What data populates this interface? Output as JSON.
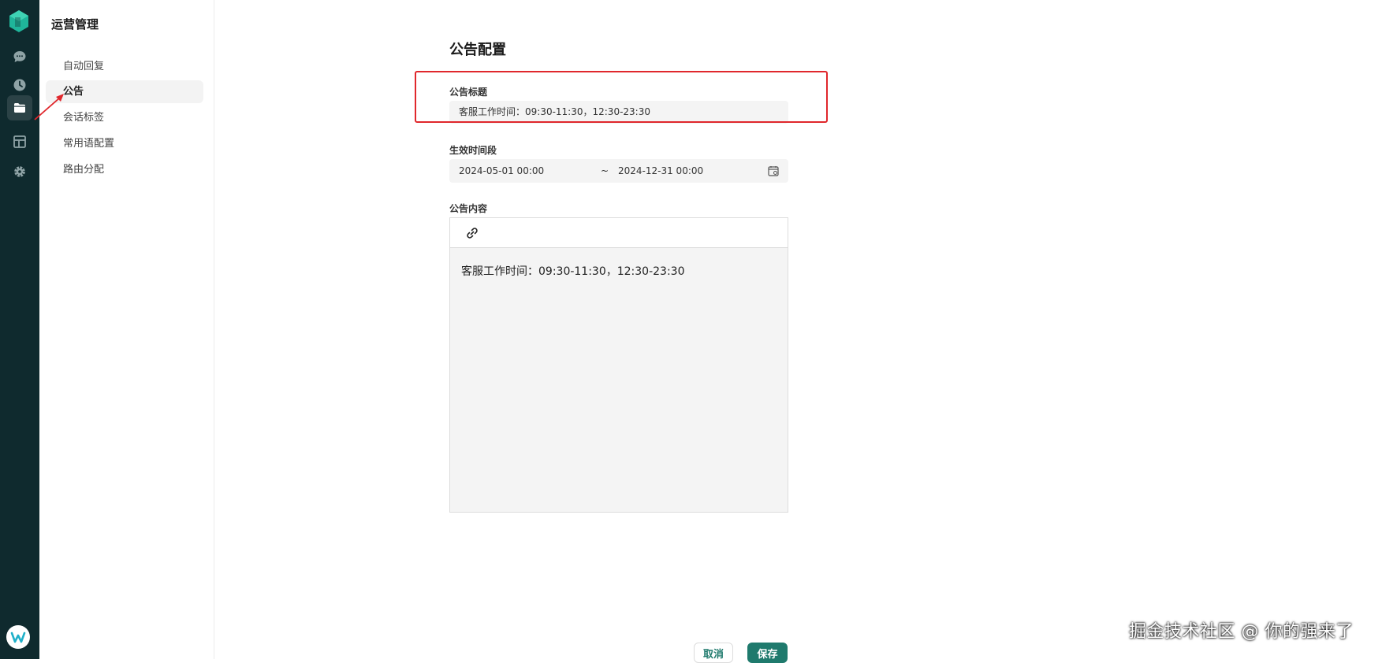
{
  "colors": {
    "rail_bg": "#0f2a2e",
    "accent": "#1f7a6d",
    "highlight": "#e0272c"
  },
  "rail": {
    "icons": [
      "chat-icon",
      "clock-icon",
      "folder-icon",
      "layout-icon",
      "gear-icon"
    ],
    "active_index": 2
  },
  "sidebar": {
    "title": "运营管理",
    "items": [
      {
        "label": "自动回复"
      },
      {
        "label": "公告",
        "active": true
      },
      {
        "label": "会话标签"
      },
      {
        "label": "常用语配置"
      },
      {
        "label": "路由分配"
      }
    ]
  },
  "form": {
    "title": "公告配置",
    "announcement_title": {
      "label": "公告标题",
      "value": "客服工作时间：09:30-11:30，12:30-23:30"
    },
    "effective_period": {
      "label": "生效时间段",
      "start": "2024-05-01 00:00",
      "separator": "~",
      "end": "2024-12-31 00:00"
    },
    "content": {
      "label": "公告内容",
      "text": "客服工作时间：09:30-11:30，12:30-23:30"
    }
  },
  "actions": {
    "cancel": "取消",
    "save": "保存"
  },
  "watermark": "掘金技术社区 @ 你的强来了"
}
